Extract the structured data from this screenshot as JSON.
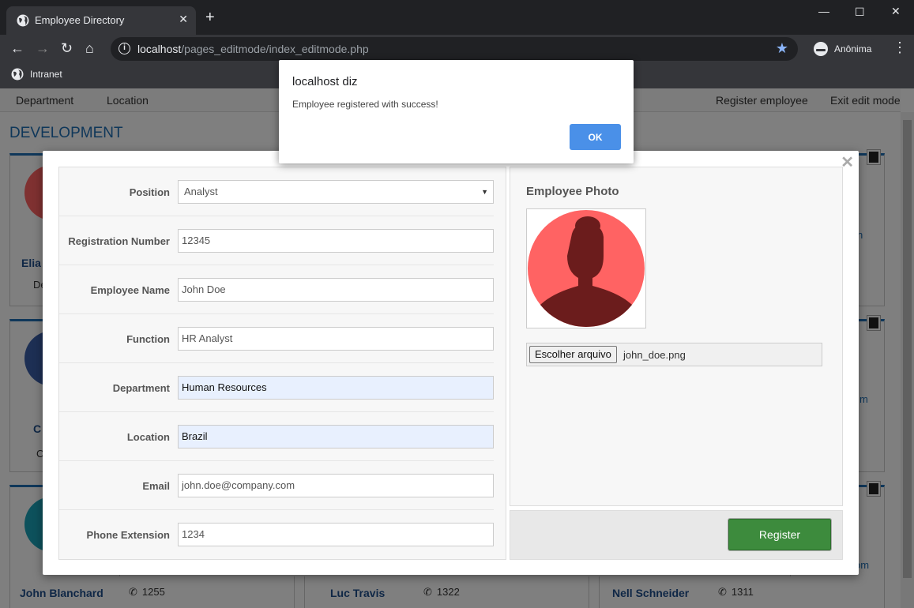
{
  "browser": {
    "tab_title": "Employee Directory",
    "url_host": "localhost",
    "url_path": "/pages_editmode/index_editmode.php",
    "profile_label": "Anônima",
    "bookmark_label": "Intranet"
  },
  "app_nav": {
    "department": "Department",
    "location": "Location",
    "register_employee": "Register employee",
    "exit_edit_mode": "Exit edit mode"
  },
  "section": {
    "title": "DEVELOPMENT"
  },
  "background_cards": {
    "partial_name_1": "Elia",
    "partial_sub_1": "De",
    "partial_name_2": "C",
    "partial_sub_2": "C",
    "side_text_1": "n",
    "side_text_2": "m",
    "side_text_3": "om",
    "footer": [
      {
        "name": "John Blanchard",
        "phone": "1255"
      },
      {
        "name": "Luc Travis",
        "phone": "1322"
      },
      {
        "name": "Nell Schneider",
        "phone": "1311"
      }
    ]
  },
  "form": {
    "position_label": "Position",
    "position_value": "Analyst",
    "registration_label": "Registration Number",
    "registration_value": "12345",
    "name_label": "Employee Name",
    "name_value": "John Doe",
    "function_label": "Function",
    "function_value": "HR Analyst",
    "department_label": "Department",
    "department_value": "Human Resources",
    "location_label": "Location",
    "location_value": "Brazil",
    "email_label": "Email",
    "email_value": "john.doe@company.com",
    "phone_label": "Phone Extension",
    "phone_value": "1234"
  },
  "photo": {
    "title": "Employee Photo",
    "choose_file_label": "Escolher arquivo",
    "file_name": "john_doe.png"
  },
  "register_button": "Register",
  "alert": {
    "title": "localhost diz",
    "message": "Employee registered with success!",
    "ok_label": "OK"
  },
  "colors": {
    "accent": "#1f6fb5",
    "register_green": "#3d8b3d",
    "ok_blue": "#4a90e8",
    "avatar_bg": "#ff6363",
    "avatar_silhouette": "#6b1c1c"
  }
}
